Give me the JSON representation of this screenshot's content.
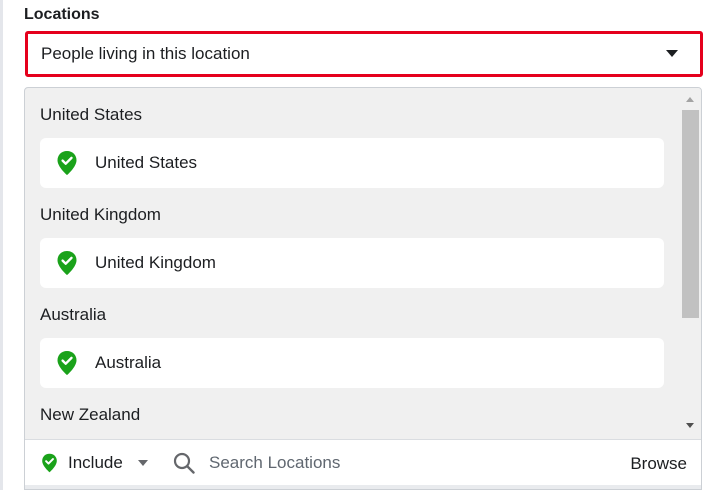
{
  "section": {
    "label": "Locations"
  },
  "location_type": {
    "selected": "People living in this location"
  },
  "groups": [
    {
      "title": "United States",
      "item": "United States"
    },
    {
      "title": "United Kingdom",
      "item": "United Kingdom"
    },
    {
      "title": "Australia",
      "item": "Australia"
    },
    {
      "title": "New Zealand"
    }
  ],
  "footer": {
    "include_label": "Include",
    "search_placeholder": "Search Locations",
    "browse_label": "Browse"
  },
  "colors": {
    "highlight_border": "#e5001c",
    "pin_green": "#1aa21a"
  },
  "icons": {
    "pin": "location-pin-check-icon",
    "caret": "caret-down-icon",
    "search": "magnifier-icon"
  }
}
